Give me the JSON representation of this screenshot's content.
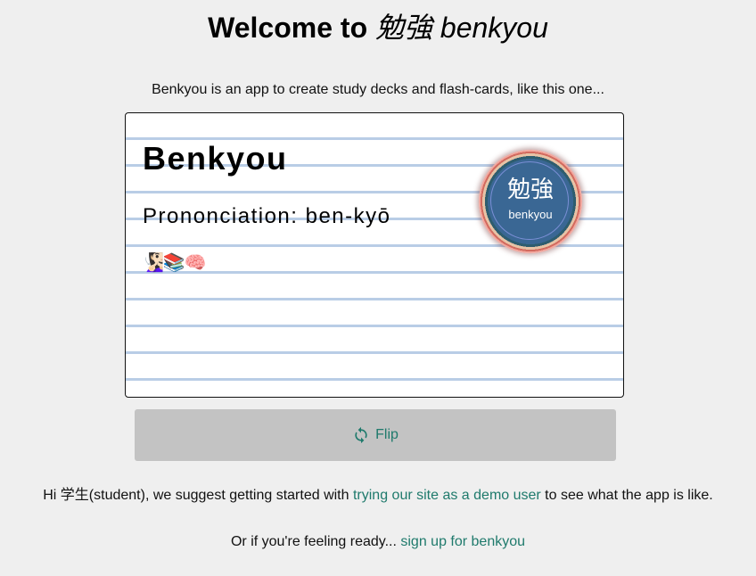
{
  "header": {
    "title_prefix": "Welcome to ",
    "title_emphasis": "勉強 benkyou"
  },
  "intro": {
    "text": "Benkyou is an app to create study decks and flash-cards, like this one..."
  },
  "card": {
    "title": "Benkyou",
    "pronunciation": "Prononciation: ben-kyō",
    "emojis": "🧏🏻‍♀️📚🧠",
    "badge": {
      "kanji": "勉強",
      "label": "benkyou"
    }
  },
  "flip_button": {
    "label": "Flip",
    "icon": "refresh-icon"
  },
  "suggestion": {
    "prefix": "Hi 学生(student), we suggest getting started with ",
    "link_text": "trying our site as a demo user",
    "suffix": " to see what the app is like."
  },
  "signup": {
    "prefix": "Or if you're feeling ready... ",
    "link_text": "sign up for benkyou"
  },
  "colors": {
    "background": "#efefef",
    "link": "#1f7a6c",
    "button_bg": "#c3c3c3",
    "card_rule": "#b9cde6",
    "badge_fill": "#3a6794"
  }
}
